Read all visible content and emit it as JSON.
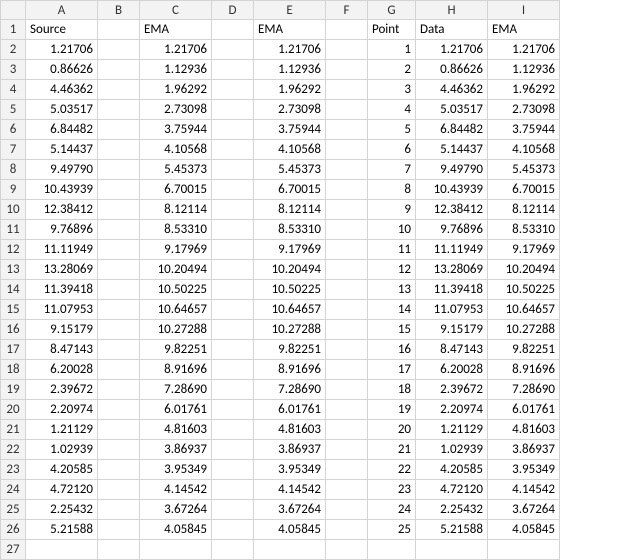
{
  "columns": [
    "A",
    "B",
    "C",
    "D",
    "E",
    "F",
    "G",
    "H",
    "I"
  ],
  "headerRow": {
    "A": "Source",
    "B": "",
    "C": "EMA",
    "D": "",
    "E": "EMA",
    "F": "",
    "G": "Point",
    "H": "Data",
    "I": "EMA"
  },
  "rows": [
    {
      "A": "1.21706",
      "C": "1.21706",
      "E": "1.21706",
      "G": "1",
      "H": "1.21706",
      "I": "1.21706"
    },
    {
      "A": "0.86626",
      "C": "1.12936",
      "E": "1.12936",
      "G": "2",
      "H": "0.86626",
      "I": "1.12936"
    },
    {
      "A": "4.46362",
      "C": "1.96292",
      "E": "1.96292",
      "G": "3",
      "H": "4.46362",
      "I": "1.96292"
    },
    {
      "A": "5.03517",
      "C": "2.73098",
      "E": "2.73098",
      "G": "4",
      "H": "5.03517",
      "I": "2.73098"
    },
    {
      "A": "6.84482",
      "C": "3.75944",
      "E": "3.75944",
      "G": "5",
      "H": "6.84482",
      "I": "3.75944"
    },
    {
      "A": "5.14437",
      "C": "4.10568",
      "E": "4.10568",
      "G": "6",
      "H": "5.14437",
      "I": "4.10568"
    },
    {
      "A": "9.49790",
      "C": "5.45373",
      "E": "5.45373",
      "G": "7",
      "H": "9.49790",
      "I": "5.45373"
    },
    {
      "A": "10.43939",
      "C": "6.70015",
      "E": "6.70015",
      "G": "8",
      "H": "10.43939",
      "I": "6.70015"
    },
    {
      "A": "12.38412",
      "C": "8.12114",
      "E": "8.12114",
      "G": "9",
      "H": "12.38412",
      "I": "8.12114"
    },
    {
      "A": "9.76896",
      "C": "8.53310",
      "E": "8.53310",
      "G": "10",
      "H": "9.76896",
      "I": "8.53310"
    },
    {
      "A": "11.11949",
      "C": "9.17969",
      "E": "9.17969",
      "G": "11",
      "H": "11.11949",
      "I": "9.17969"
    },
    {
      "A": "13.28069",
      "C": "10.20494",
      "E": "10.20494",
      "G": "12",
      "H": "13.28069",
      "I": "10.20494"
    },
    {
      "A": "11.39418",
      "C": "10.50225",
      "E": "10.50225",
      "G": "13",
      "H": "11.39418",
      "I": "10.50225"
    },
    {
      "A": "11.07953",
      "C": "10.64657",
      "E": "10.64657",
      "G": "14",
      "H": "11.07953",
      "I": "10.64657"
    },
    {
      "A": "9.15179",
      "C": "10.27288",
      "E": "10.27288",
      "G": "15",
      "H": "9.15179",
      "I": "10.27288"
    },
    {
      "A": "8.47143",
      "C": "9.82251",
      "E": "9.82251",
      "G": "16",
      "H": "8.47143",
      "I": "9.82251"
    },
    {
      "A": "6.20028",
      "C": "8.91696",
      "E": "8.91696",
      "G": "17",
      "H": "6.20028",
      "I": "8.91696"
    },
    {
      "A": "2.39672",
      "C": "7.28690",
      "E": "7.28690",
      "G": "18",
      "H": "2.39672",
      "I": "7.28690"
    },
    {
      "A": "2.20974",
      "C": "6.01761",
      "E": "6.01761",
      "G": "19",
      "H": "2.20974",
      "I": "6.01761"
    },
    {
      "A": "1.21129",
      "C": "4.81603",
      "E": "4.81603",
      "G": "20",
      "H": "1.21129",
      "I": "4.81603"
    },
    {
      "A": "1.02939",
      "C": "3.86937",
      "E": "3.86937",
      "G": "21",
      "H": "1.02939",
      "I": "3.86937"
    },
    {
      "A": "4.20585",
      "C": "3.95349",
      "E": "3.95349",
      "G": "22",
      "H": "4.20585",
      "I": "3.95349"
    },
    {
      "A": "4.72120",
      "C": "4.14542",
      "E": "4.14542",
      "G": "23",
      "H": "4.72120",
      "I": "4.14542"
    },
    {
      "A": "2.25432",
      "C": "3.67264",
      "E": "3.67264",
      "G": "24",
      "H": "2.25432",
      "I": "3.67264"
    },
    {
      "A": "5.21588",
      "C": "4.05845",
      "E": "4.05845",
      "G": "25",
      "H": "5.21588",
      "I": "4.05845"
    }
  ]
}
